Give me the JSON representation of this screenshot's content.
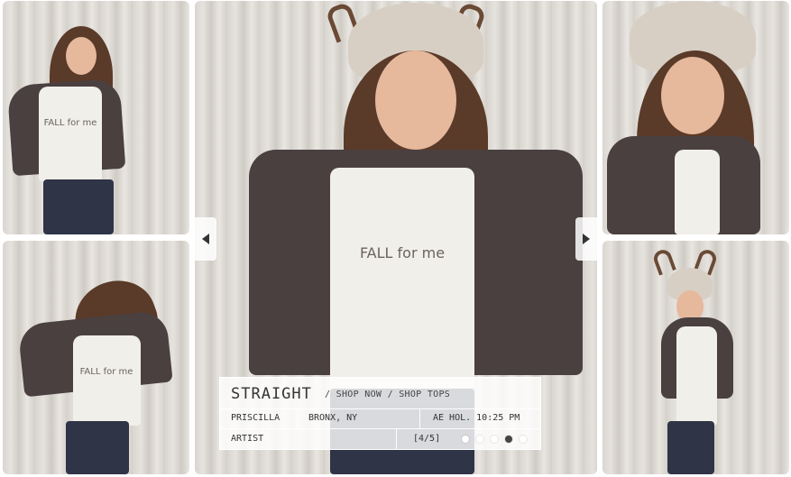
{
  "gallery": {
    "thumbnails": [
      {
        "id": "thumb-top-left"
      },
      {
        "id": "thumb-bottom-left"
      },
      {
        "id": "thumb-top-right"
      },
      {
        "id": "thumb-bottom-right"
      }
    ],
    "main_image": {
      "shirt_text": "FALL for me"
    }
  },
  "nav": {
    "prev_icon": "chevron-left-icon",
    "next_icon": "chevron-right-icon"
  },
  "info": {
    "headline": "STRAIGHT",
    "separator": "/",
    "shop_now": "SHOP NOW",
    "shop_tops": "SHOP TOPS",
    "name": "PRISCILLA",
    "location": "BRONX, NY",
    "time": "AE HOL. 10:25 PM",
    "role": "ARTIST",
    "counter": "[4/5]",
    "current_index": 4,
    "total": 5
  },
  "colors": {
    "panel_bg": "#ffffff",
    "dot_active": "#444444",
    "dot_inactive": "#ffffff"
  }
}
